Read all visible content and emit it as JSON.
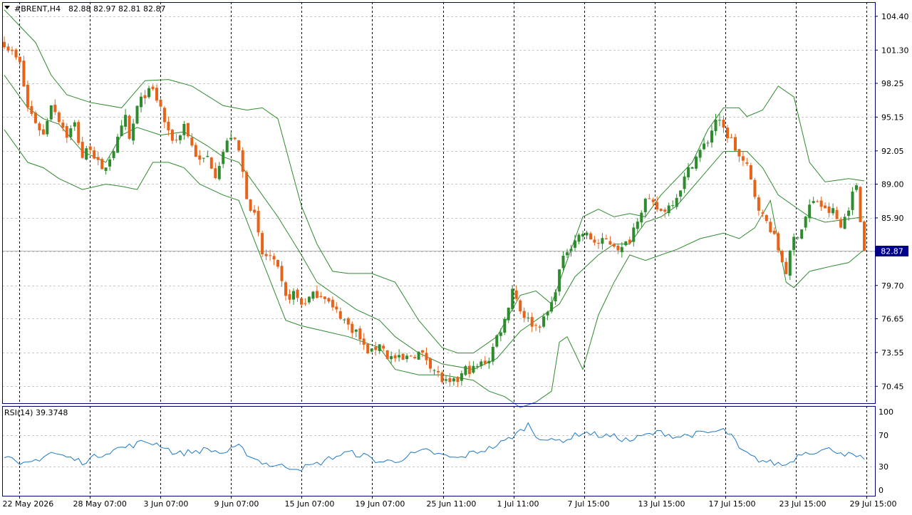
{
  "header": {
    "symbol": "#BRENT,H4",
    "ohlc": "82.88 82.97 82.81 82.87"
  },
  "indicator": {
    "label": "RSI(14) 39.3748"
  },
  "colors": {
    "bull": "#2e8b2e",
    "bear": "#e8631a",
    "bands": "#2e8b2e",
    "rsi": "#1e78c8",
    "grid": "#c8c8c8",
    "price_box": "#00008b"
  },
  "chart_data": [
    {
      "type": "candlestick",
      "ylim": [
        68.9,
        105.7
      ],
      "y_ticks": [
        "104.40",
        "101.30",
        "98.25",
        "95.15",
        "92.05",
        "89.00",
        "85.90",
        "82.80",
        "79.70",
        "76.65",
        "73.55",
        "70.45"
      ],
      "current_price_label": "82.87",
      "current_price": 82.87,
      "x_ticks": [
        "22 May 2026",
        "28 May 07:00",
        "3 Jun 07:00",
        "9 Jun 07:00",
        "15 Jun 07:00",
        "19 Jun 07:00",
        "25 Jun 11:00",
        "1 Jul 11:00",
        "7 Jul 15:00",
        "13 Jul 15:00",
        "17 Jul 15:00",
        "23 Jul 15:00",
        "29 Jul 15:00"
      ],
      "close_path": [
        [
          0,
          102.0
        ],
        [
          4,
          100.0
        ],
        [
          6,
          96.0
        ],
        [
          10,
          93.5
        ],
        [
          12,
          96.5
        ],
        [
          16,
          93.5
        ],
        [
          18,
          94.5
        ],
        [
          20,
          91.5
        ],
        [
          22,
          92.5
        ],
        [
          25,
          90.0
        ],
        [
          27,
          91.5
        ],
        [
          29,
          93.0
        ],
        [
          31,
          95.0
        ],
        [
          32,
          93.0
        ],
        [
          34,
          96.0
        ],
        [
          36,
          97.3
        ],
        [
          38,
          97.5
        ],
        [
          40,
          96.0
        ],
        [
          42,
          93.5
        ],
        [
          44,
          93.0
        ],
        [
          46,
          94.5
        ],
        [
          48,
          92.5
        ],
        [
          50,
          91.0
        ],
        [
          52,
          91.5
        ],
        [
          54,
          90.0
        ],
        [
          56,
          92.0
        ],
        [
          58,
          93.5
        ],
        [
          60,
          92.0
        ],
        [
          62,
          88.0
        ],
        [
          64,
          86.0
        ],
        [
          66,
          82.5
        ],
        [
          68,
          82.3
        ],
        [
          70,
          81.0
        ],
        [
          72,
          78.5
        ],
        [
          74,
          79.0
        ],
        [
          76,
          78.0
        ],
        [
          78,
          78.5
        ],
        [
          80,
          79.0
        ],
        [
          82,
          78.8
        ],
        [
          84,
          77.5
        ],
        [
          86,
          77.0
        ],
        [
          88,
          76.0
        ],
        [
          90,
          75.5
        ],
        [
          92,
          74.0
        ],
        [
          94,
          73.5
        ],
        [
          96,
          74.5
        ],
        [
          98,
          73.2
        ],
        [
          100,
          73.0
        ],
        [
          102,
          72.8
        ],
        [
          104,
          73.3
        ],
        [
          106,
          73.5
        ],
        [
          108,
          73.0
        ],
        [
          110,
          72.0
        ],
        [
          112,
          71.0
        ],
        [
          114,
          70.5
        ],
        [
          116,
          71.0
        ],
        [
          118,
          72.0
        ],
        [
          120,
          72.0
        ],
        [
          122,
          72.5
        ],
        [
          124,
          73.0
        ],
        [
          126,
          75.0
        ],
        [
          128,
          76.5
        ],
        [
          130,
          79.5
        ],
        [
          132,
          77.5
        ],
        [
          134,
          76.5
        ],
        [
          136,
          76.0
        ],
        [
          138,
          76.5
        ],
        [
          140,
          78.0
        ],
        [
          142,
          81.0
        ],
        [
          144,
          83.0
        ],
        [
          146,
          84.0
        ],
        [
          148,
          84.5
        ],
        [
          150,
          84.0
        ],
        [
          152,
          83.5
        ],
        [
          154,
          83.8
        ],
        [
          156,
          83.5
        ],
        [
          158,
          83.0
        ],
        [
          160,
          84.0
        ],
        [
          162,
          86.0
        ],
        [
          164,
          87.5
        ],
        [
          166,
          87.0
        ],
        [
          168,
          86.5
        ],
        [
          170,
          87.0
        ],
        [
          172,
          88.0
        ],
        [
          174,
          89.5
        ],
        [
          176,
          91.0
        ],
        [
          178,
          92.0
        ],
        [
          180,
          93.0
        ],
        [
          182,
          95.0
        ],
        [
          184,
          94.0
        ],
        [
          186,
          93.0
        ],
        [
          188,
          91.5
        ],
        [
          190,
          90.5
        ],
        [
          192,
          88.0
        ],
        [
          194,
          86.0
        ],
        [
          196,
          85.0
        ],
        [
          198,
          83.0
        ],
        [
          200,
          81.0
        ],
        [
          202,
          84.0
        ],
        [
          204,
          85.0
        ],
        [
          206,
          87.0
        ],
        [
          208,
          87.5
        ],
        [
          210,
          86.5
        ],
        [
          212,
          86.5
        ],
        [
          214,
          85.0
        ],
        [
          216,
          87.0
        ],
        [
          218,
          89.0
        ],
        [
          220,
          82.87
        ]
      ],
      "bb_upper": [
        [
          0,
          105.0
        ],
        [
          8,
          102.0
        ],
        [
          12,
          99.0
        ],
        [
          16,
          97.2
        ],
        [
          22,
          96.5
        ],
        [
          30,
          96.0
        ],
        [
          36,
          98.5
        ],
        [
          42,
          98.6
        ],
        [
          48,
          98.0
        ],
        [
          56,
          96.2
        ],
        [
          62,
          95.8
        ],
        [
          66,
          96.0
        ],
        [
          70,
          95.0
        ],
        [
          76,
          87.0
        ],
        [
          80,
          83.5
        ],
        [
          84,
          81.0
        ],
        [
          88,
          80.8
        ],
        [
          94,
          80.8
        ],
        [
          100,
          80.0
        ],
        [
          106,
          76.5
        ],
        [
          112,
          74.0
        ],
        [
          116,
          73.5
        ],
        [
          120,
          73.5
        ],
        [
          126,
          75.0
        ],
        [
          132,
          78.8
        ],
        [
          136,
          79.2
        ],
        [
          140,
          78.0
        ],
        [
          144,
          82.0
        ],
        [
          148,
          86.0
        ],
        [
          152,
          86.7
        ],
        [
          156,
          86.0
        ],
        [
          160,
          86.3
        ],
        [
          164,
          86.0
        ],
        [
          168,
          88.0
        ],
        [
          172,
          89.5
        ],
        [
          176,
          91.0
        ],
        [
          180,
          94.0
        ],
        [
          184,
          96.0
        ],
        [
          188,
          96.0
        ],
        [
          190,
          95.2
        ],
        [
          194,
          95.8
        ],
        [
          198,
          98.0
        ],
        [
          202,
          97.0
        ],
        [
          206,
          91.0
        ],
        [
          210,
          89.2
        ],
        [
          216,
          89.5
        ],
        [
          220,
          89.3
        ]
      ],
      "bb_middle": [
        [
          0,
          99.0
        ],
        [
          6,
          96.0
        ],
        [
          10,
          95.0
        ],
        [
          14,
          94.5
        ],
        [
          20,
          92.0
        ],
        [
          26,
          91.0
        ],
        [
          30,
          93.5
        ],
        [
          34,
          94.2
        ],
        [
          40,
          93.5
        ],
        [
          46,
          93.8
        ],
        [
          52,
          92.5
        ],
        [
          56,
          91.5
        ],
        [
          60,
          91.0
        ],
        [
          66,
          88.0
        ],
        [
          70,
          86.0
        ],
        [
          76,
          82.5
        ],
        [
          80,
          80.0
        ],
        [
          86,
          78.5
        ],
        [
          90,
          77.5
        ],
        [
          96,
          76.5
        ],
        [
          100,
          75.0
        ],
        [
          106,
          73.5
        ],
        [
          112,
          72.5
        ],
        [
          120,
          72.0
        ],
        [
          126,
          73.0
        ],
        [
          132,
          75.5
        ],
        [
          138,
          77.0
        ],
        [
          142,
          78.0
        ],
        [
          146,
          80.5
        ],
        [
          152,
          82.5
        ],
        [
          156,
          83.5
        ],
        [
          160,
          83.5
        ],
        [
          164,
          85.5
        ],
        [
          168,
          86.0
        ],
        [
          172,
          87.0
        ],
        [
          178,
          89.5
        ],
        [
          184,
          92.0
        ],
        [
          190,
          92.0
        ],
        [
          194,
          90.5
        ],
        [
          198,
          88.0
        ],
        [
          202,
          87.0
        ],
        [
          206,
          86.0
        ],
        [
          210,
          85.5
        ],
        [
          216,
          85.8
        ],
        [
          220,
          86.0
        ]
      ],
      "bb_lower": [
        [
          0,
          94.0
        ],
        [
          6,
          91.0
        ],
        [
          10,
          90.5
        ],
        [
          14,
          89.5
        ],
        [
          20,
          88.5
        ],
        [
          26,
          89.0
        ],
        [
          30,
          88.8
        ],
        [
          34,
          88.5
        ],
        [
          38,
          91.0
        ],
        [
          42,
          91.0
        ],
        [
          46,
          90.5
        ],
        [
          50,
          89.0
        ],
        [
          56,
          88.0
        ],
        [
          60,
          87.5
        ],
        [
          66,
          82.0
        ],
        [
          72,
          76.5
        ],
        [
          76,
          76.0
        ],
        [
          82,
          75.5
        ],
        [
          88,
          75.0
        ],
        [
          96,
          74.0
        ],
        [
          100,
          72.0
        ],
        [
          106,
          71.5
        ],
        [
          112,
          71.5
        ],
        [
          120,
          71.0
        ],
        [
          124,
          70.0
        ],
        [
          128,
          69.5
        ],
        [
          132,
          68.5
        ],
        [
          136,
          69.0
        ],
        [
          140,
          70.0
        ],
        [
          142,
          74.5
        ],
        [
          144,
          75.0
        ],
        [
          146,
          73.5
        ],
        [
          148,
          72.0
        ],
        [
          152,
          77.0
        ],
        [
          156,
          80.0
        ],
        [
          160,
          82.5
        ],
        [
          164,
          82.0
        ],
        [
          168,
          82.5
        ],
        [
          172,
          83.0
        ],
        [
          178,
          84.0
        ],
        [
          184,
          84.5
        ],
        [
          188,
          84.0
        ],
        [
          192,
          85.0
        ],
        [
          196,
          87.5
        ],
        [
          200,
          80.0
        ],
        [
          202,
          79.5
        ],
        [
          206,
          81.0
        ],
        [
          212,
          81.5
        ],
        [
          216,
          81.8
        ],
        [
          220,
          83.0
        ]
      ]
    },
    {
      "type": "line",
      "name": "RSI(14)",
      "ylim": [
        0,
        100
      ],
      "y_ticks": [
        100,
        70,
        30,
        0
      ],
      "levels": [
        70,
        30
      ],
      "values": [
        [
          0,
          45
        ],
        [
          4,
          30
        ],
        [
          8,
          38
        ],
        [
          12,
          48
        ],
        [
          16,
          42
        ],
        [
          20,
          36
        ],
        [
          24,
          44
        ],
        [
          28,
          52
        ],
        [
          32,
          56
        ],
        [
          36,
          62
        ],
        [
          40,
          58
        ],
        [
          44,
          46
        ],
        [
          48,
          49
        ],
        [
          52,
          52
        ],
        [
          56,
          47
        ],
        [
          60,
          55
        ],
        [
          64,
          40
        ],
        [
          68,
          32
        ],
        [
          72,
          30
        ],
        [
          76,
          28
        ],
        [
          80,
          33
        ],
        [
          84,
          42
        ],
        [
          88,
          48
        ],
        [
          92,
          44
        ],
        [
          96,
          36
        ],
        [
          100,
          37
        ],
        [
          104,
          45
        ],
        [
          108,
          50
        ],
        [
          112,
          44
        ],
        [
          116,
          40
        ],
        [
          120,
          48
        ],
        [
          124,
          53
        ],
        [
          128,
          62
        ],
        [
          132,
          75
        ],
        [
          134,
          84
        ],
        [
          136,
          70
        ],
        [
          140,
          62
        ],
        [
          144,
          65
        ],
        [
          148,
          74
        ],
        [
          152,
          70
        ],
        [
          156,
          68
        ],
        [
          160,
          63
        ],
        [
          164,
          70
        ],
        [
          168,
          74
        ],
        [
          172,
          68
        ],
        [
          176,
          71
        ],
        [
          180,
          73
        ],
        [
          184,
          76
        ],
        [
          186,
          70
        ],
        [
          188,
          52
        ],
        [
          192,
          40
        ],
        [
          196,
          35
        ],
        [
          200,
          32
        ],
        [
          204,
          48
        ],
        [
          208,
          50
        ],
        [
          212,
          52
        ],
        [
          216,
          45
        ],
        [
          220,
          39.37
        ]
      ]
    }
  ]
}
